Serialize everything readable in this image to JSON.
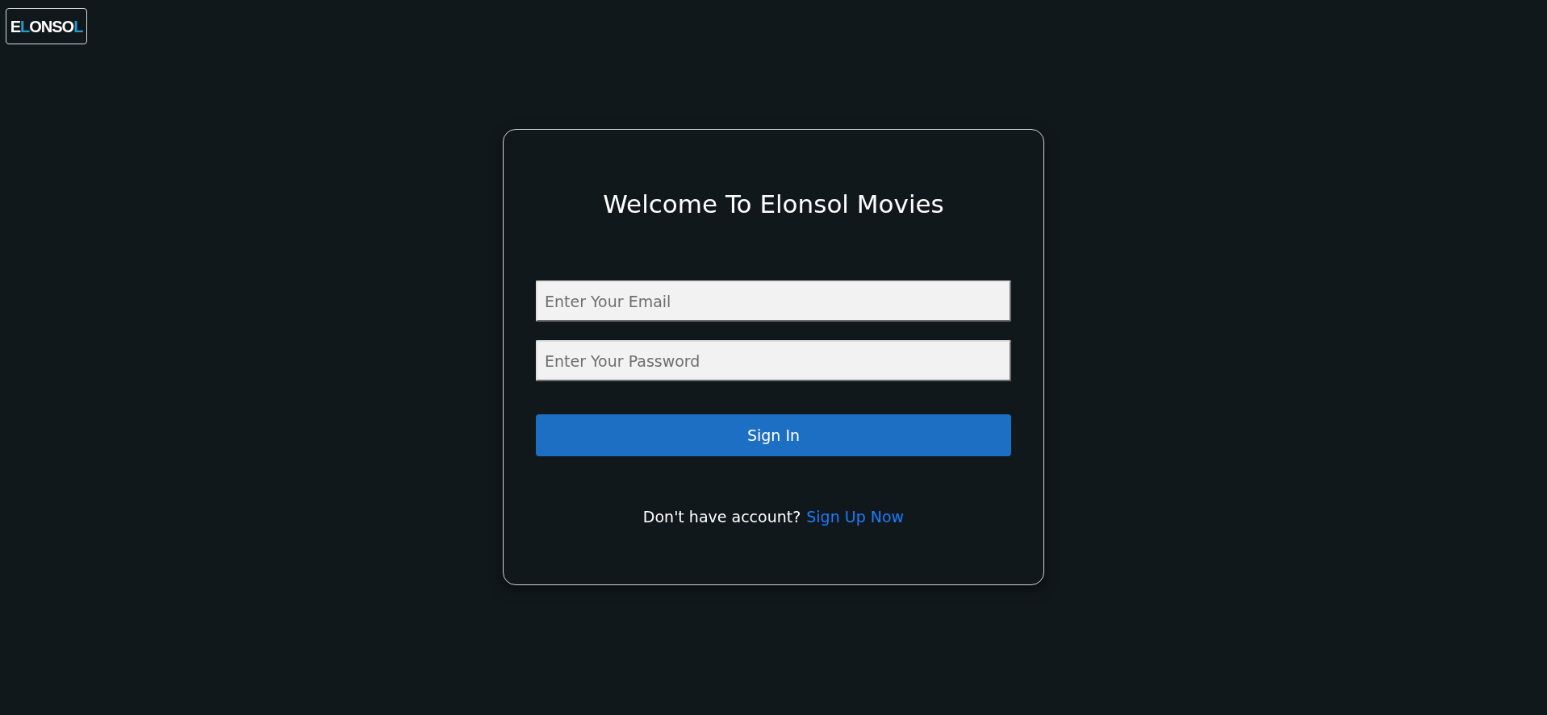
{
  "logo": {
    "parts": [
      {
        "text": "E",
        "accent": false
      },
      {
        "text": "L",
        "accent": true
      },
      {
        "text": "ONSO",
        "accent": false
      },
      {
        "text": "L",
        "accent": true
      }
    ]
  },
  "card": {
    "title": "Welcome To Elonsol Movies",
    "fields": [
      {
        "placeholder": "Enter Your Email"
      },
      {
        "placeholder": "Enter Your Password"
      }
    ],
    "submit": "Sign In",
    "footer": {
      "text": "Don't have account?",
      "link": "Sign Up Now"
    }
  }
}
